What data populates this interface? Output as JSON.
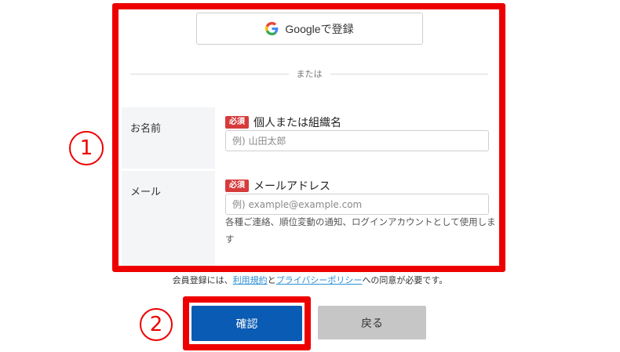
{
  "google_signup": {
    "label": "Googleで登録",
    "icon": "google-g-icon"
  },
  "divider": {
    "text": "または"
  },
  "form": {
    "name": {
      "label": "お名前",
      "required_badge": "必須",
      "title": "個人または組織名",
      "placeholder": "例) 山田太郎",
      "value": ""
    },
    "email": {
      "label": "メール",
      "required_badge": "必須",
      "title": "メールアドレス",
      "placeholder": "例) example@example.com",
      "value": "",
      "help": "各種ご連絡、順位変動の通知、ログインアカウントとして使用します"
    }
  },
  "agreement": {
    "prefix": "会員登録には、",
    "terms_link": "利用規約",
    "conjunction": "と",
    "privacy_link": "プライバシーポリシー",
    "suffix": "への同意が必要です。"
  },
  "buttons": {
    "confirm": "確認",
    "back": "戻る"
  },
  "annotations": {
    "marker_1": "1",
    "marker_2": "2"
  },
  "colors": {
    "highlight": "#ee0000",
    "confirm_button": "#0a5bb3",
    "back_button": "#c6c6c6",
    "required_badge": "#d63b3b",
    "link": "#2a8fd6"
  }
}
